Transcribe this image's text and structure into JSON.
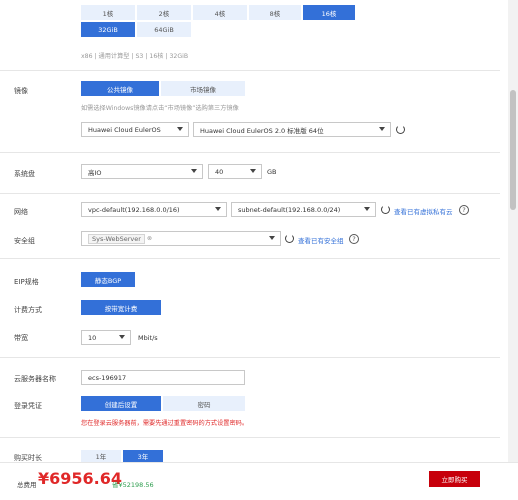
{
  "flavor": {
    "cpus": [
      "1核",
      "2核",
      "4核",
      "8核",
      "16核"
    ],
    "mem": [
      "32GiB",
      "64GiB"
    ],
    "summary": "x86 | 通用计算型 | S3 | 16核 | 32GiB"
  },
  "image": {
    "label": "镜像",
    "tabs": [
      "公共镜像",
      "市场镜像"
    ],
    "hint": "如需选择Windows镜像请点击“市场镜像”选购第三方镜像",
    "os": "Huawei Cloud EulerOS",
    "version": "Huawei Cloud EulerOS 2.0 标准版 64位"
  },
  "disk": {
    "label": "系统盘",
    "type": "高IO",
    "size": "40",
    "unit": "GB"
  },
  "network": {
    "label": "网络",
    "vpc": "vpc-default(192.168.0.0/16)",
    "subnet": "subnet-default(192.168.0.0/24)",
    "link": "查看已有虚拟私有云"
  },
  "security": {
    "label": "安全组",
    "tag": "Sys-WebServer",
    "link": "查看已有安全组"
  },
  "eip": {
    "label": "EIP规格",
    "value": "静态BGP"
  },
  "billing": {
    "label": "计费方式",
    "value": "按带宽计费"
  },
  "bandwidth": {
    "label": "带宽",
    "value": "10",
    "unit": "Mbit/s"
  },
  "name": {
    "label": "云服务器名称",
    "value": "ecs-196917"
  },
  "login": {
    "label": "登录凭证",
    "tabs": [
      "创建后设置",
      "密码"
    ],
    "warning": "您在登录云服务器前，需要先通过重置密码的方式设置密码。"
  },
  "duration": {
    "label": "购买时长",
    "options": [
      "1年",
      "3年"
    ]
  },
  "footer": {
    "total_label": "总费用",
    "price": "¥6956.64",
    "saving": "省¥52198.56",
    "buy": "立即购买"
  },
  "colors": {
    "accent": "#3370d8",
    "price": "#e02828",
    "buy": "#c7000b"
  }
}
